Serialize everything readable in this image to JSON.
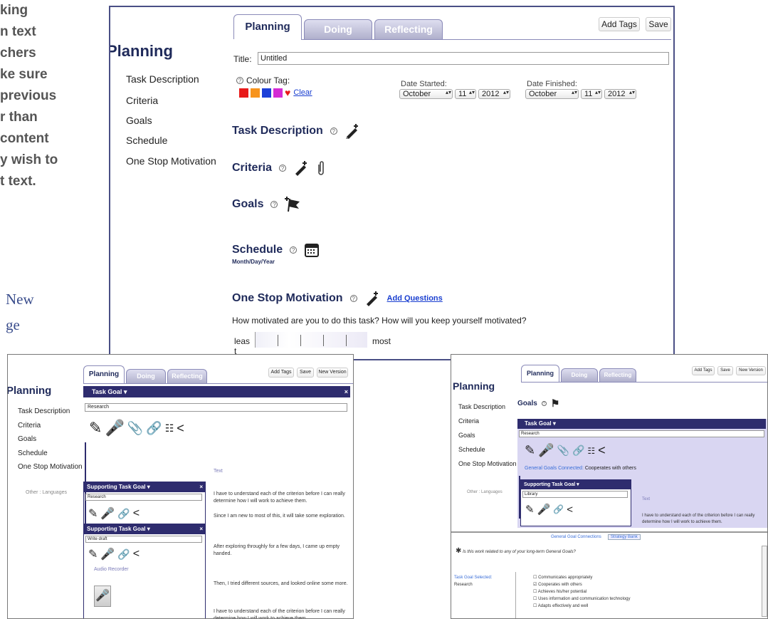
{
  "left_text": {
    "lines": [
      "king",
      "n text",
      "chers",
      "ke sure",
      "previous",
      "r than",
      "content",
      "y wish to",
      "t text."
    ],
    "link_lines": [
      "New",
      "ge"
    ]
  },
  "main_window": {
    "tabs": [
      "Planning",
      "Doing",
      "Reflecting"
    ],
    "buttons": {
      "add_tags": "Add Tags",
      "save": "Save"
    },
    "page_title": "Planning",
    "sidebar": [
      "Task Description",
      "Criteria",
      "Goals",
      "Schedule",
      "One Stop Motivation"
    ],
    "title_label": "Title:",
    "title_value": "Untitled",
    "colour_tag_label": "Colour Tag:",
    "clear_label": "Clear",
    "swatches": [
      "#e81a1a",
      "#f7941d",
      "#1c3fd8",
      "#d42bd4"
    ],
    "date_started": {
      "label": "Date Started:",
      "month": "October",
      "day": "11",
      "year": "2012"
    },
    "date_finished": {
      "label": "Date Finished:",
      "month": "October",
      "day": "11",
      "year": "2012"
    },
    "help_glyph": "?",
    "sections": {
      "task_description": "Task Description",
      "criteria": "Criteria",
      "goals": "Goals",
      "schedule": "Schedule",
      "schedule_sub": "Month/Day/Year",
      "motivation": "One Stop Motivation",
      "add_questions": "Add Questions"
    },
    "motivation_question": "How motivated are you to do this task? How will you keep yourself motivated?",
    "scale": {
      "least": "leas",
      "least_t": "t",
      "most": "most"
    }
  },
  "left_window": {
    "tabs": [
      "Planning",
      "Doing",
      "Reflecting"
    ],
    "buttons": {
      "add_tags": "Add Tags",
      "save": "Save",
      "new_version": "New Version"
    },
    "page_title": "Planning",
    "sidebar": [
      "Task Description",
      "Criteria",
      "Goals",
      "Schedule",
      "One Stop Motivation"
    ],
    "other_languages": "Other : Languages",
    "task_goal": {
      "title": "Task Goal",
      "value": "Research"
    },
    "supporting1": {
      "title": "Supporting Task Goal",
      "value": "Research"
    },
    "supporting2": {
      "title": "Supporting Task Goal",
      "value": "Write draft"
    },
    "audio_recorder": "Audio Recorder",
    "text_label": "Text",
    "notes": [
      "I have to understand each of the criterion before I can really determine how I will work to achieve them.",
      "Since I am new to most of this, it will take some exploration.",
      "After exploring throughly for a few days, I came up empty handed.",
      "Then, I tried different sources, and looked online some more.",
      "I have to understand each of the criterion before I can really determine how I will work to achieve them."
    ],
    "glyph_close": "×",
    "glyph_plus": "+"
  },
  "right_window": {
    "tabs": [
      "Planning",
      "Doing",
      "Reflecting"
    ],
    "buttons": {
      "add_tags": "Add Tags",
      "save": "Save",
      "new_version": "New Version"
    },
    "page_title": "Planning",
    "sidebar": [
      "Task Description",
      "Criteria",
      "Goals",
      "Schedule",
      "One Stop Motivation"
    ],
    "other_languages": "Other : Languages",
    "goals_label": "Goals",
    "task_goal": {
      "title": "Task Goal",
      "value": "Research"
    },
    "general_goals_connected": "General Goals Connected:",
    "connected_value": "Cooperates with others",
    "supporting": {
      "title": "Supporting Task Goal",
      "value": "Library"
    },
    "text_label": "Text",
    "note": "I have to understand each of the criterion before I can really determine how I will work to achieve them.",
    "connections_tab": "General Goal Connections",
    "strategy_tab": "Strategy Bank",
    "question": "Is this work related to any of your long-term General Goals?",
    "task_goal_selected_label": "Task Goal Selected:",
    "task_goal_selected_value": "Research",
    "checklist": [
      "Communicates appropriately",
      "Cooperates with others",
      "Achieves his/her potential",
      "Uses information and communication technology",
      "Adapts effectively and well"
    ],
    "check_on": "☑",
    "check_off": "☐"
  },
  "colors": {
    "dark_bar": "#2e2c6e",
    "title_blue": "#1f2a5a",
    "link_blue": "#1a3fd0",
    "panel_purple": "#d9d6f2"
  }
}
